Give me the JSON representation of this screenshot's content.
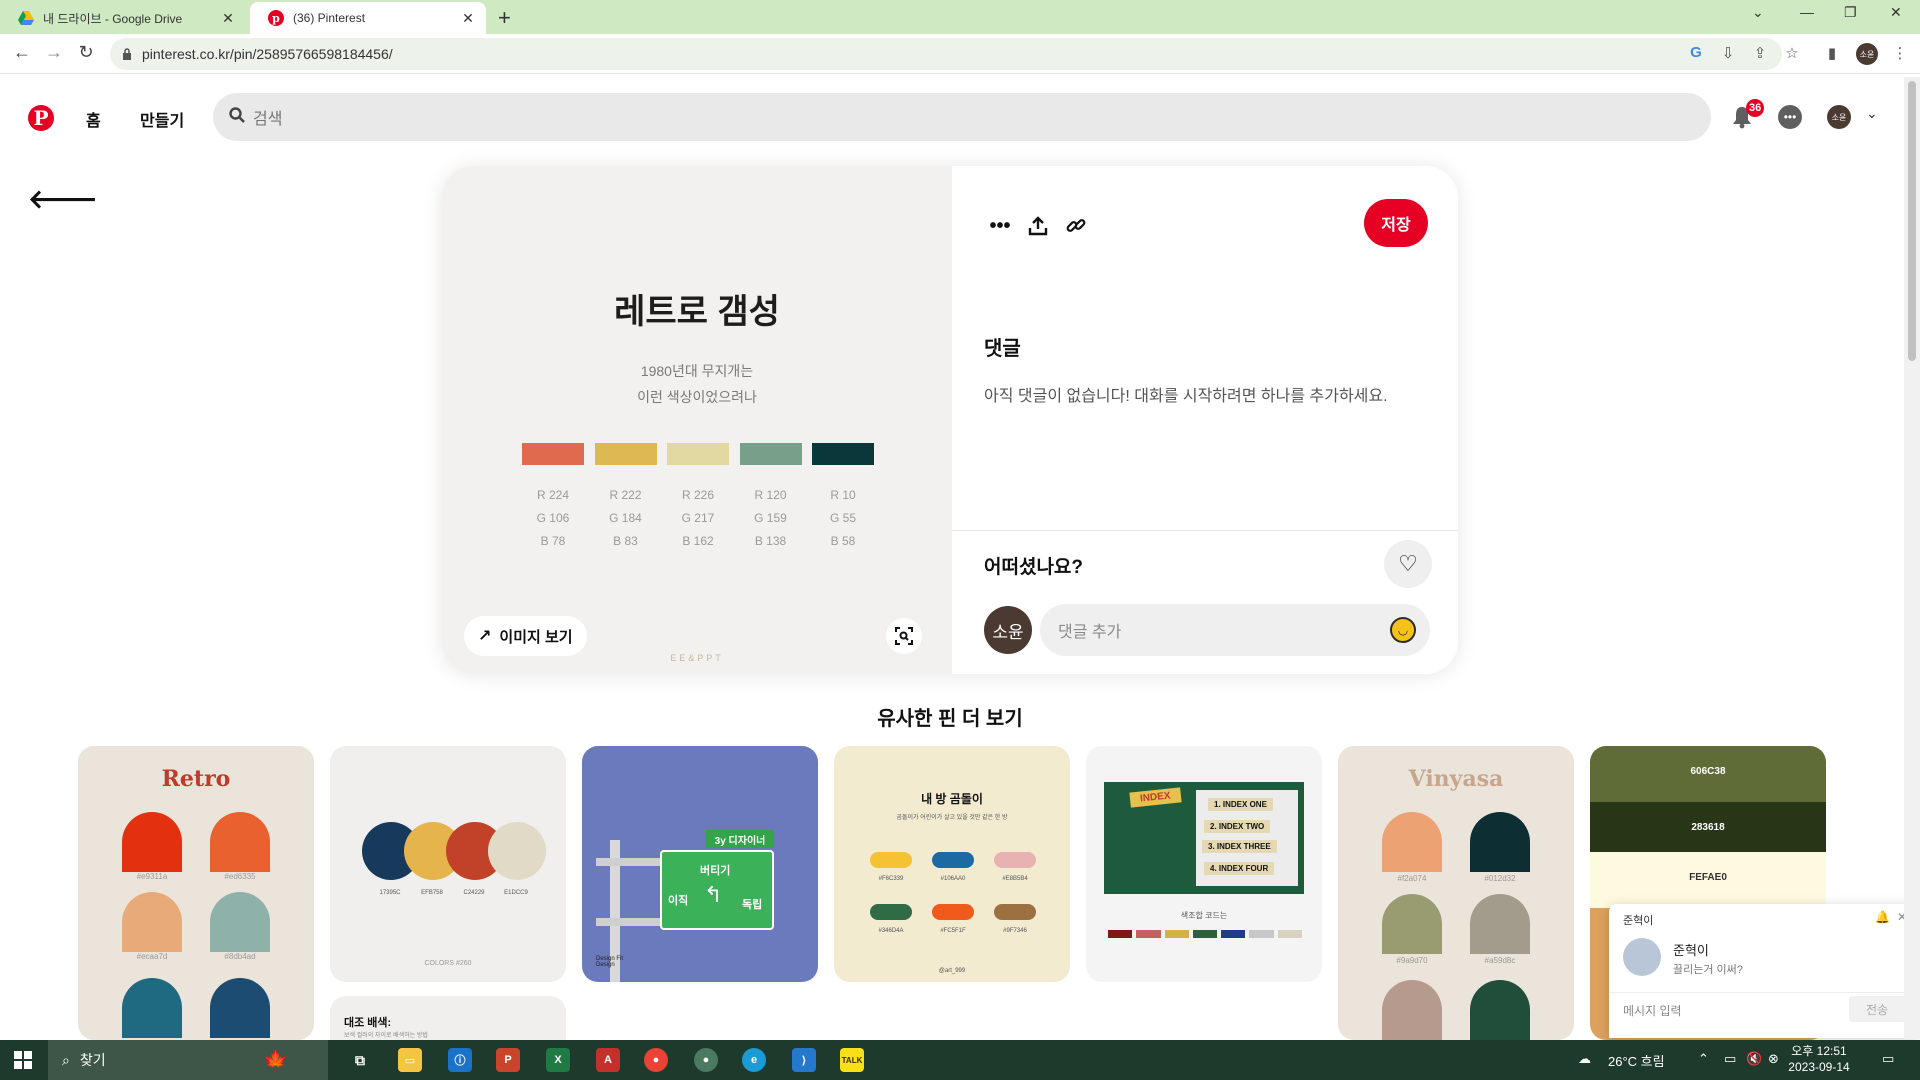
{
  "browser": {
    "tabs": [
      {
        "title": "내 드라이브 - Google Drive",
        "active": false
      },
      {
        "title": "(36) Pinterest",
        "active": true
      }
    ],
    "url": "pinterest.co.kr/pin/258957665981844​56/"
  },
  "header": {
    "logo": "P",
    "nav_home": "홈",
    "nav_create": "만들기",
    "search_placeholder": "검색",
    "notification_count": "36",
    "profile_initials": "소윤"
  },
  "pin": {
    "image_title": "레트로 갬성",
    "image_subtitle_1": "1980년대 무지개는",
    "image_subtitle_2": "이런 색상이었으려나",
    "swatches": [
      {
        "color": "#e06a4e",
        "r": "R 224",
        "g": "G 106",
        "b": "B 78"
      },
      {
        "color": "#deb853",
        "r": "R 222",
        "g": "G 184",
        "b": "B 83"
      },
      {
        "color": "#e2d9a2",
        "r": "R 226",
        "g": "G 217",
        "b": "B 162"
      },
      {
        "color": "#789f8a",
        "r": "R 120",
        "g": "G 159",
        "b": "B 138"
      },
      {
        "color": "#0a373a",
        "r": "R 10",
        "g": "G 55",
        "b": "B 58"
      }
    ],
    "watermark": "EE&PPT",
    "view_image_label": "이미지 보기",
    "save_label": "저장",
    "comments_heading": "댓글",
    "comments_empty": "아직 댓글이 없습니다! 대화를 시작하려면 하나를 추가하세요.",
    "how_was_it": "어떠셨나요?",
    "comment_avatar": "소윤",
    "comment_placeholder": "댓글 추가"
  },
  "more_pins_title": "유사한 핀 더 보기",
  "grid": {
    "retro": {
      "title": "Retro",
      "codes": [
        "#e9311a",
        "#ed6335",
        "#ecaa7d",
        "#8db4ad"
      ]
    },
    "colors260": {
      "codes": [
        "17395C",
        "EFB758",
        "C24229",
        "E1DCC9"
      ],
      "caption": "COLORS #260",
      "card2_title": "대조 배색:",
      "card2_sub": "보색 컬러의 차이로 배색하는 방법"
    },
    "sign": {
      "top": "3y 디자이너",
      "left": "버티기",
      "left2": "이직",
      "right": "독립",
      "logo": "Design Fit Design"
    },
    "myroom": {
      "title": "내 방 곰돌이",
      "sub": "곰돌이가 어린이가 살고 있을 것만 같은 한 방",
      "codes": [
        "#F6C339",
        "#106AA0",
        "#E8B5B4",
        "#346D4A",
        "#FC5F1F",
        "#9F7346"
      ],
      "foot": "@art_999"
    },
    "index": {
      "tag": "INDEX",
      "items": [
        "1. INDEX ONE",
        "2. INDEX TWO",
        "3. INDEX THREE",
        "4. INDEX FOUR"
      ],
      "caption": "색조합 코드는"
    },
    "vinyasa": {
      "title": "Vinyasa",
      "codes": [
        "#f2a074",
        "#012d32",
        "#9a9d70",
        "#a59d8c"
      ]
    },
    "green": {
      "codes": [
        "606C38",
        "283618",
        "FEFAE0"
      ]
    }
  },
  "messenger": {
    "window_title": "준혁이",
    "sender": "준혁이",
    "message": "끌리는거 이써?",
    "input_placeholder": "메시지 입력",
    "send_label": "전송"
  },
  "taskbar": {
    "search_label": "찾기",
    "weather": "26°C 흐림",
    "time": "오후 12:51",
    "date": "2023-09-14"
  }
}
